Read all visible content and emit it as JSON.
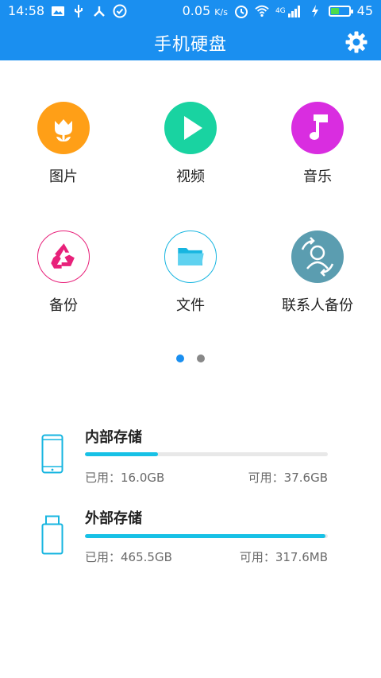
{
  "status_bar": {
    "time": "14:58",
    "speed_value": "0.05",
    "speed_unit": "K/s",
    "battery_level": "45",
    "battery_fill": 0.45,
    "icons": [
      "image-icon",
      "usb-icon",
      "share-icon",
      "check-circle-icon",
      "clock-icon",
      "wifi-icon",
      "signal-icon",
      "charging-icon"
    ],
    "network": "4G"
  },
  "app_bar": {
    "title": "手机硬盘",
    "settings_icon": "gear-icon"
  },
  "grid": {
    "items": [
      {
        "label": "图片",
        "icon": "tulip-icon",
        "color": "#ff9f17"
      },
      {
        "label": "视频",
        "icon": "play-icon",
        "color": "#19d3a1"
      },
      {
        "label": "音乐",
        "icon": "music-note-icon",
        "color": "#d92de0"
      },
      {
        "label": "备份",
        "icon": "recycle-icon",
        "color": "#e8217a"
      },
      {
        "label": "文件",
        "icon": "folder-icon",
        "color": "#17b5e0"
      },
      {
        "label": "联系人备份",
        "icon": "contact-sync-icon",
        "color": "#5b9db0"
      }
    ],
    "page_count": 2,
    "current_page": 0
  },
  "storage": [
    {
      "title": "内部存储",
      "used": "已用：16.0GB",
      "free": "可用：37.6GB",
      "used_fraction": 0.3,
      "icon": "phone-icon"
    },
    {
      "title": "外部存储",
      "used": "已用：465.5GB",
      "free": "可用：317.6MB",
      "used_fraction": 0.99,
      "icon": "usb-drive-icon"
    }
  ],
  "colors": {
    "primary": "#1a8ff0",
    "accent_bar": "#17c1e6",
    "dot_active": "#1a8ff0",
    "dot_inactive": "#888888"
  }
}
